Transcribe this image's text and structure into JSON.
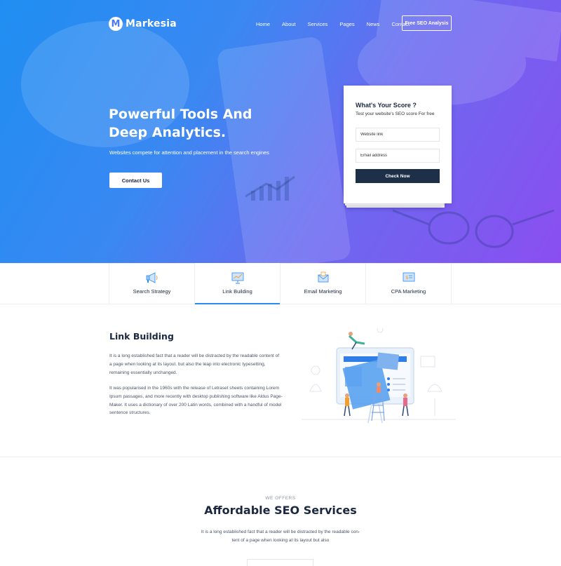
{
  "brand": {
    "logo_letter": "M",
    "name": "Markesia"
  },
  "nav": {
    "items": [
      {
        "label": "Home"
      },
      {
        "label": "About"
      },
      {
        "label": "Services"
      },
      {
        "label": "Pages"
      },
      {
        "label": "News"
      },
      {
        "label": "Contact"
      }
    ],
    "cta_label": "Free SEO Analysis"
  },
  "hero": {
    "title_line1": "Powerful Tools And",
    "title_line2": "Deep Analytics.",
    "subtitle": "Websites compete for attention and placement in the search engines",
    "button_label": "Contact Us",
    "gradient": {
      "start": "#1f8ef2",
      "end": "#8b4ef0"
    }
  },
  "score_card": {
    "title": "What's Your Score ?",
    "subtitle": "Test your website's SEO score For free",
    "website_placeholder": "Website link",
    "email_placeholder": "Email address",
    "button_label": "Check Now",
    "button_color": "#1e3048"
  },
  "tabs": [
    {
      "label": "Search Strategy",
      "icon": "megaphone-icon",
      "active": false
    },
    {
      "label": "Link Building",
      "icon": "presentation-chart-icon",
      "active": true
    },
    {
      "label": "Email Marketing",
      "icon": "envelope-icon",
      "active": false
    },
    {
      "label": "CPA Marketing",
      "icon": "dollar-screen-icon",
      "active": false
    }
  ],
  "accent_color": "#2a8af0",
  "link_building": {
    "title": "Link Building",
    "paragraph1_lines": [
      "It is a long established fact that a reader will be distracted by the readable content of",
      "a page when looking at its layout.  but also the leap into electronic typesetting,",
      "remaining essentially unchanged."
    ],
    "paragraph2_lines": [
      "It was popularised in the 1960s with the release of Letraset sheets containing Lorem",
      "Ipsum passages, and more recently with desktop publishing software like Aldus Page-",
      "Maker. It uses a dictionary of over 200 Latin words, combined with a handful of model",
      "sentence structures."
    ]
  },
  "offers": {
    "kicker": "WE OFFERS",
    "title": "Affordable SEO Services",
    "description_lines": [
      "It is a long established fact that a reader will be distracted by the readable con-",
      "tent of a page when looking at its layout  but also"
    ]
  }
}
